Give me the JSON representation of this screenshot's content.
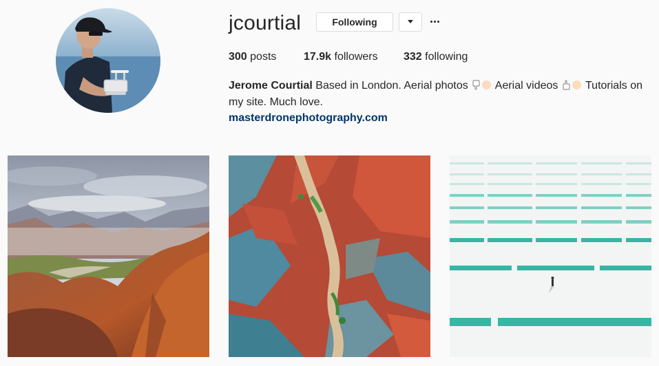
{
  "profile": {
    "username": "jcourtial",
    "follow_button_label": "Following",
    "avatar_icon": "profile-photo",
    "dropdown_icon": "chevron-down-icon",
    "more_icon": "more-options-icon",
    "stats": {
      "posts_count": "300",
      "posts_label": "posts",
      "followers_count": "17.9k",
      "followers_label": "followers",
      "following_count": "332",
      "following_label": "following"
    },
    "bio": {
      "full_name": "Jerome Courtial",
      "text_1": "Based in London. Aerial photos",
      "text_2": "Aerial videos",
      "text_3": "Tutorials on my site. Much love.",
      "emoji_1": "pointing-down-hand-icon",
      "emoji_2": "pointing-up-hand-icon"
    },
    "website": "masterdronephotography.com"
  },
  "posts": [
    {
      "subject": "mountain-valley-photo"
    },
    {
      "subject": "red-canyon-river-aerial-photo"
    },
    {
      "subject": "salt-flats-aerial-photo"
    }
  ],
  "colors": {
    "background": "#fafafa",
    "text": "#262626",
    "link": "#003569",
    "border": "#dbdbdb"
  }
}
